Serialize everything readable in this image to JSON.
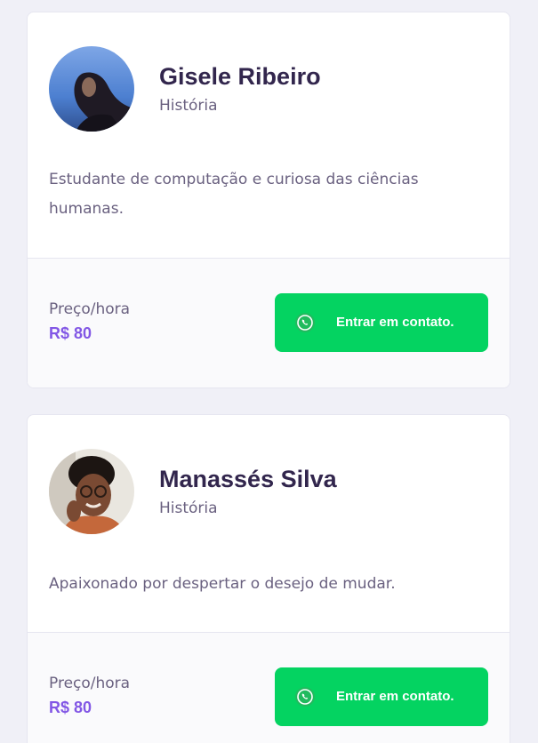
{
  "teachers": [
    {
      "name": "Gisele Ribeiro",
      "subject": "História",
      "bio": "Estudante de computação e curiosa das ciências humanas.",
      "price_label": "Preço/hora",
      "price_value": "R$ 80",
      "contact_label": "Entrar em contato."
    },
    {
      "name": "Manassés Silva",
      "subject": "História",
      "bio": "Apaixonado por despertar o desejo de mudar.",
      "price_label": "Preço/hora",
      "price_value": "R$ 80",
      "contact_label": "Entrar em contato."
    }
  ],
  "colors": {
    "background": "#f0f0f7",
    "card": "#ffffff",
    "footer": "#fafafc",
    "title": "#32264d",
    "text": "#6a6180",
    "price": "#8257e5",
    "button": "#04d361"
  },
  "icons": {
    "contact_button_icon": "whatsapp-icon"
  }
}
